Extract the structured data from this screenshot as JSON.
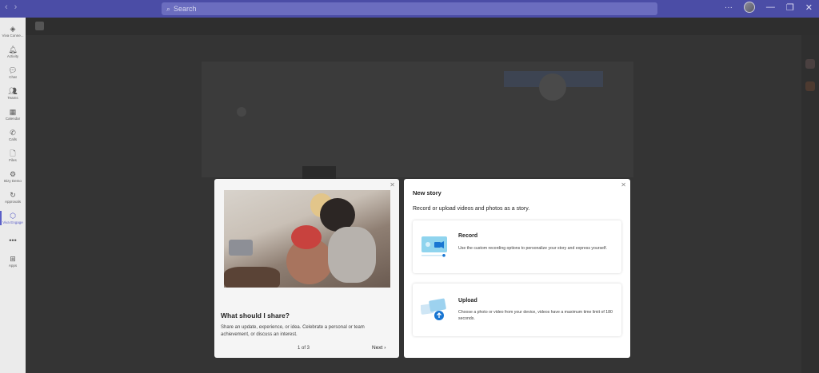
{
  "titlebar": {
    "search_placeholder": "Search",
    "more": "···"
  },
  "rail": [
    {
      "label": "Viva Conne...",
      "icon": "viva-connections-icon",
      "glyph": "◈"
    },
    {
      "label": "Activity",
      "icon": "bell-icon",
      "glyph": "🔔︎"
    },
    {
      "label": "Chat",
      "icon": "chat-icon",
      "glyph": "💬︎"
    },
    {
      "label": "Teams",
      "icon": "teams-icon",
      "glyph": "👥︎"
    },
    {
      "label": "Calendar",
      "icon": "calendar-icon",
      "glyph": "▦"
    },
    {
      "label": "Calls",
      "icon": "phone-icon",
      "glyph": "✆"
    },
    {
      "label": "Files",
      "icon": "file-icon",
      "glyph": "🗋"
    },
    {
      "label": "Bizy Demo",
      "icon": "bizy-demo-icon",
      "glyph": "⚙"
    },
    {
      "label": "Approvals",
      "icon": "approvals-icon",
      "glyph": "↻"
    },
    {
      "label": "Viva Engage",
      "icon": "viva-engage-icon",
      "glyph": "⬡"
    },
    {
      "label": "",
      "icon": "more-apps-icon",
      "glyph": "•••"
    },
    {
      "label": "Apps",
      "icon": "apps-icon",
      "glyph": "⊞"
    }
  ],
  "colors": {
    "accent": "#5b5fc7",
    "titlebar": "#4b4da6",
    "overlay": "#343434"
  },
  "tips": {
    "heading": "What should I share?",
    "body": "Share an update, experience, or idea. Celebrate a personal or team achievement, or discuss an interest.",
    "pager": "1 of 3",
    "next_label": "Next"
  },
  "new_story": {
    "title": "New story",
    "subtitle": "Record or upload videos and photos as a story.",
    "options": [
      {
        "title": "Record",
        "description": "Use the custom recording options to personalize your story and express yourself."
      },
      {
        "title": "Upload",
        "description": "Choose a photo or video from your device, videos have a maximum time limit of 180 seconds."
      }
    ]
  }
}
